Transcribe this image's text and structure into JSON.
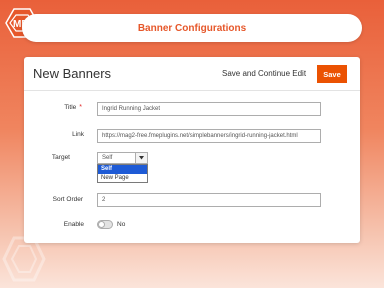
{
  "header": {
    "title": "Banner Configurations"
  },
  "panel": {
    "title": "New Banners",
    "save_continue_label": "Save and Continue Edit",
    "save_label": "Save"
  },
  "form": {
    "title": {
      "label": "Title",
      "required_mark": "*",
      "value": "Ingrid Running Jacket"
    },
    "link": {
      "label": "Link",
      "value": "https://mag2-free.fmeplugins.net/simplebanners/ingrid-running-jacket.html"
    },
    "target": {
      "label": "Target",
      "value": "Self",
      "options": [
        "Self",
        "New Page"
      ]
    },
    "sort_order": {
      "label": "Sort Order",
      "value": "2"
    },
    "enable": {
      "label": "Enable",
      "state_label": "No"
    }
  },
  "colors": {
    "accent": "#e6572a",
    "save_button": "#eb5202",
    "selection": "#1e5bd6"
  },
  "icons": {
    "logo": "fme-logo",
    "select": "chevron-down-icon"
  }
}
